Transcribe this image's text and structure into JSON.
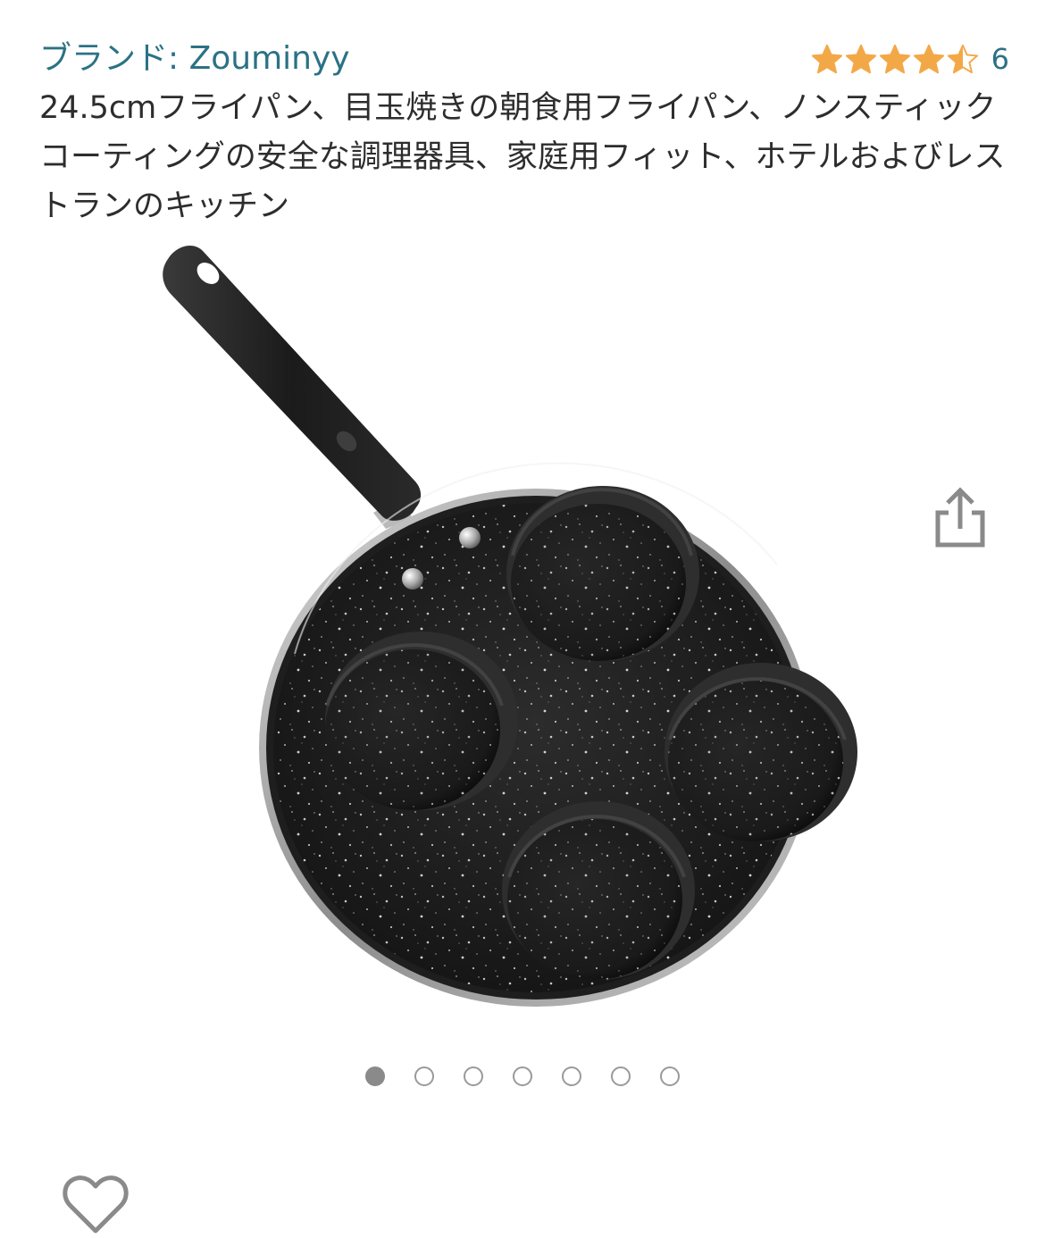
{
  "brand": {
    "link_text": "ブランド: Zouminyy"
  },
  "rating": {
    "value": 4.5,
    "max": 5,
    "count": "6",
    "star_color": "#f3a847"
  },
  "product": {
    "title": "24.5cmフライパン、目玉焼きの朝食用フライパン、ノンスティックコーティングの安全な調理器具、家庭用フィット、ホテルおよびレストランのキッチン"
  },
  "icons": {
    "share": "share-icon",
    "wishlist": "heart-icon"
  },
  "carousel": {
    "total": 7,
    "active_index": 0
  },
  "colors": {
    "link": "#2b7285",
    "title_text": "#2d2d2d",
    "icon_gray": "#8a8a8a"
  }
}
